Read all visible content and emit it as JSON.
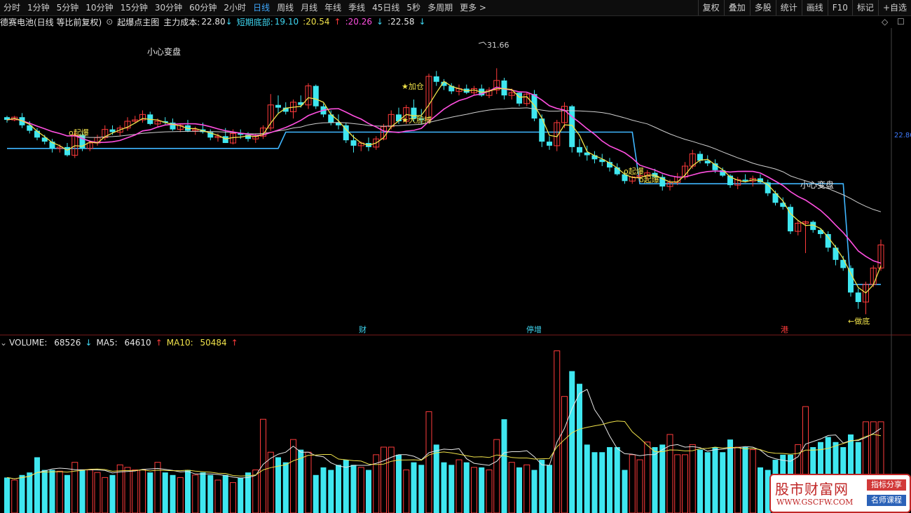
{
  "toolbar": {
    "periods": [
      "分时",
      "1分钟",
      "5分钟",
      "10分钟",
      "15分钟",
      "30分钟",
      "60分钟",
      "2小时",
      "日线",
      "周线",
      "月线",
      "年线",
      "季线",
      "45日线",
      "5秒",
      "多周期",
      "更多 >"
    ],
    "active_period": "日线",
    "tools": [
      "复权",
      "叠加",
      "多股",
      "统计",
      "画线",
      "F10",
      "标记",
      "+自选"
    ]
  },
  "info": {
    "stock": "德赛电池(日线 等比前复权)",
    "indicator": "起爆点主图",
    "cost_label": "主力成本:",
    "cost_value": "22.80",
    "bottom_label": "短期底部:",
    "bottom_value": "19.10",
    "v1": "20.54",
    "v2": "20.26",
    "v3": "22.58"
  },
  "volume_info": {
    "volume_label": "VOLUME:",
    "volume_value": "68526",
    "ma5_label": "MA5:",
    "ma5_value": "64610",
    "ma10_label": "MA10:",
    "ma10_value": "50484"
  },
  "annotations": {
    "xinxin1": "小心变盘",
    "xinxin2": "小心变盘",
    "qibao1": "o起爆",
    "qibao2": "o起爆",
    "qibao3": "o起爆",
    "jiacang": "★加仓",
    "dadan": "★大胆搏",
    "high": "31.66",
    "low": "←做底",
    "cai": "财",
    "tingzeng": "停增",
    "gang": "港"
  },
  "colors": {
    "up": "#ff3b3b",
    "down": "#3fe7f0",
    "ma_white": "#cfcfcf",
    "ma_yellow": "#f0e24a",
    "ma_magenta": "#ff4fe0",
    "support": "#3fb6ff"
  },
  "chart_data": {
    "type": "candlestick",
    "candles": [
      [
        26.2,
        26.3,
        25.8,
        26.0
      ],
      [
        26.0,
        26.3,
        25.9,
        26.2
      ],
      [
        26.2,
        26.5,
        25.4,
        25.6
      ],
      [
        25.6,
        25.9,
        25.0,
        25.2
      ],
      [
        25.2,
        25.4,
        24.5,
        24.7
      ],
      [
        24.7,
        24.9,
        24.2,
        24.4
      ],
      [
        24.4,
        24.6,
        23.6,
        23.9
      ],
      [
        23.9,
        24.2,
        23.6,
        24.0
      ],
      [
        24.0,
        24.3,
        23.3,
        23.4
      ],
      [
        23.4,
        25.2,
        23.2,
        24.9
      ],
      [
        24.9,
        25.1,
        23.7,
        23.9
      ],
      [
        23.9,
        24.5,
        23.7,
        24.3
      ],
      [
        24.3,
        24.9,
        24.1,
        24.7
      ],
      [
        24.7,
        25.6,
        24.5,
        25.3
      ],
      [
        25.3,
        25.6,
        24.9,
        25.1
      ],
      [
        25.1,
        25.6,
        24.8,
        25.4
      ],
      [
        25.4,
        26.2,
        25.2,
        25.9
      ],
      [
        25.9,
        26.3,
        25.8,
        26.0
      ],
      [
        26.0,
        26.7,
        25.8,
        26.4
      ],
      [
        26.4,
        26.6,
        25.6,
        25.7
      ],
      [
        25.7,
        26.1,
        25.5,
        25.9
      ],
      [
        25.9,
        26.2,
        25.6,
        25.8
      ],
      [
        25.8,
        26.1,
        25.2,
        25.3
      ],
      [
        25.3,
        25.7,
        25.1,
        25.6
      ],
      [
        25.6,
        26.0,
        25.1,
        25.2
      ],
      [
        25.2,
        25.5,
        24.9,
        25.3
      ],
      [
        25.3,
        25.8,
        25.0,
        25.1
      ],
      [
        25.1,
        25.3,
        24.5,
        24.7
      ],
      [
        24.7,
        25.0,
        24.4,
        24.8
      ],
      [
        24.8,
        25.4,
        24.3,
        24.3
      ],
      [
        24.3,
        25.3,
        24.2,
        25.0
      ],
      [
        25.0,
        25.3,
        24.6,
        24.9
      ],
      [
        24.9,
        25.1,
        24.4,
        24.6
      ],
      [
        24.6,
        25.0,
        24.3,
        24.8
      ],
      [
        24.8,
        25.6,
        24.6,
        25.4
      ],
      [
        25.4,
        27.9,
        25.2,
        27.1
      ],
      [
        27.1,
        27.8,
        26.5,
        26.9
      ],
      [
        26.9,
        27.3,
        26.4,
        26.6
      ],
      [
        26.6,
        27.5,
        26.1,
        27.3
      ],
      [
        27.3,
        27.8,
        26.9,
        27.1
      ],
      [
        27.1,
        28.7,
        26.8,
        28.5
      ],
      [
        28.5,
        28.6,
        26.8,
        27.0
      ],
      [
        27.0,
        27.2,
        26.2,
        26.4
      ],
      [
        26.4,
        26.7,
        25.6,
        25.8
      ],
      [
        25.8,
        26.4,
        25.3,
        25.6
      ],
      [
        25.6,
        25.8,
        24.3,
        24.5
      ],
      [
        24.5,
        24.9,
        23.6,
        24.1
      ],
      [
        24.1,
        24.4,
        23.7,
        24.3
      ],
      [
        24.3,
        24.7,
        23.7,
        24.0
      ],
      [
        24.0,
        24.8,
        23.8,
        24.6
      ],
      [
        24.6,
        25.7,
        24.5,
        25.5
      ],
      [
        25.5,
        26.7,
        25.3,
        26.4
      ],
      [
        26.4,
        26.9,
        25.7,
        25.9
      ],
      [
        25.9,
        27.1,
        25.7,
        26.9
      ],
      [
        26.9,
        27.5,
        25.9,
        26.1
      ],
      [
        26.1,
        26.8,
        25.7,
        26.0
      ],
      [
        26.0,
        29.4,
        25.9,
        29.2
      ],
      [
        29.2,
        29.6,
        28.5,
        28.8
      ],
      [
        28.8,
        29.0,
        28.2,
        28.5
      ],
      [
        28.5,
        28.7,
        27.9,
        28.1
      ],
      [
        28.1,
        28.6,
        27.8,
        28.3
      ],
      [
        28.3,
        28.6,
        27.9,
        28.0
      ],
      [
        28.0,
        28.5,
        27.8,
        28.3
      ],
      [
        28.3,
        28.6,
        27.7,
        27.8
      ],
      [
        27.8,
        28.4,
        27.6,
        28.2
      ],
      [
        28.2,
        29.8,
        27.9,
        28.9
      ],
      [
        28.9,
        29.1,
        27.5,
        27.8
      ],
      [
        27.8,
        28.3,
        27.5,
        28.0
      ],
      [
        28.0,
        28.0,
        27.0,
        27.2
      ],
      [
        27.2,
        28.0,
        27.0,
        27.9
      ],
      [
        27.9,
        28.2,
        25.9,
        26.1
      ],
      [
        26.1,
        26.4,
        24.0,
        24.4
      ],
      [
        24.4,
        24.8,
        23.8,
        24.1
      ],
      [
        24.1,
        26.0,
        23.7,
        25.8
      ],
      [
        25.8,
        27.3,
        25.4,
        27.0
      ],
      [
        27.0,
        27.1,
        23.6,
        24.0
      ],
      [
        24.0,
        24.6,
        23.3,
        23.6
      ],
      [
        23.6,
        24.1,
        23.0,
        23.4
      ],
      [
        23.4,
        23.7,
        22.8,
        23.1
      ],
      [
        23.1,
        23.5,
        22.6,
        22.9
      ],
      [
        22.9,
        23.2,
        22.2,
        22.5
      ],
      [
        22.5,
        22.8,
        21.9,
        22.0
      ],
      [
        22.0,
        22.2,
        21.3,
        21.5
      ],
      [
        21.5,
        21.9,
        21.3,
        21.8
      ],
      [
        21.8,
        22.2,
        21.5,
        21.9
      ],
      [
        21.9,
        22.3,
        21.6,
        22.1
      ],
      [
        22.1,
        22.4,
        21.7,
        21.8
      ],
      [
        21.8,
        22.0,
        20.8,
        21.1
      ],
      [
        21.1,
        21.6,
        20.8,
        21.4
      ],
      [
        21.4,
        22.1,
        21.2,
        21.8
      ],
      [
        21.8,
        22.9,
        21.6,
        22.6
      ],
      [
        22.6,
        23.8,
        22.4,
        23.5
      ],
      [
        23.5,
        23.7,
        22.8,
        23.0
      ],
      [
        23.0,
        23.4,
        22.6,
        22.8
      ],
      [
        22.8,
        23.1,
        22.1,
        22.3
      ],
      [
        22.3,
        22.5,
        21.8,
        21.9
      ],
      [
        21.9,
        22.0,
        21.0,
        21.2
      ],
      [
        21.2,
        21.8,
        20.9,
        21.6
      ],
      [
        21.6,
        22.0,
        21.4,
        21.5
      ],
      [
        21.5,
        21.9,
        21.1,
        21.7
      ],
      [
        21.7,
        22.0,
        21.3,
        21.4
      ],
      [
        21.4,
        21.6,
        20.4,
        20.6
      ],
      [
        20.6,
        20.8,
        19.7,
        19.9
      ],
      [
        19.9,
        20.3,
        19.4,
        19.6
      ],
      [
        19.6,
        19.8,
        17.6,
        17.8
      ],
      [
        17.8,
        18.6,
        17.5,
        18.4
      ],
      [
        18.4,
        18.6,
        16.2,
        18.5
      ],
      [
        18.5,
        18.6,
        17.7,
        17.9
      ],
      [
        17.9,
        18.0,
        17.3,
        17.6
      ],
      [
        17.6,
        17.8,
        16.3,
        16.6
      ],
      [
        16.6,
        16.8,
        15.3,
        15.7
      ],
      [
        15.7,
        16.0,
        14.9,
        15.1
      ],
      [
        15.1,
        15.3,
        13.0,
        13.3
      ],
      [
        13.3,
        13.6,
        12.1,
        12.6
      ],
      [
        12.6,
        14.1,
        11.7,
        13.9
      ],
      [
        13.9,
        15.3,
        13.7,
        15.1
      ],
      [
        15.1,
        17.2,
        14.9,
        16.8
      ]
    ],
    "volume": [
      28,
      26,
      30,
      32,
      44,
      34,
      34,
      33,
      30,
      40,
      34,
      34,
      32,
      28,
      30,
      38,
      36,
      34,
      34,
      32,
      40,
      32,
      30,
      28,
      34,
      30,
      32,
      30,
      26,
      30,
      24,
      28,
      32,
      34,
      74,
      48,
      44,
      40,
      58,
      50,
      48,
      30,
      36,
      34,
      38,
      42,
      38,
      36,
      34,
      46,
      52,
      52,
      46,
      34,
      40,
      38,
      80,
      54,
      40,
      38,
      42,
      40,
      36,
      36,
      34,
      58,
      74,
      40,
      36,
      38,
      34,
      42,
      38,
      128,
      92,
      112,
      102,
      54,
      48,
      48,
      52,
      52,
      34,
      46,
      42,
      56,
      52,
      54,
      62,
      46,
      46,
      54,
      50,
      48,
      52,
      48,
      58,
      52,
      52,
      50,
      36,
      34,
      42,
      46,
      46,
      54,
      84,
      52,
      56,
      60,
      56,
      52,
      62,
      56,
      72,
      72,
      72
    ],
    "ma5_value": 64610,
    "ma10_value": 50484,
    "latest_volume": 68526
  }
}
